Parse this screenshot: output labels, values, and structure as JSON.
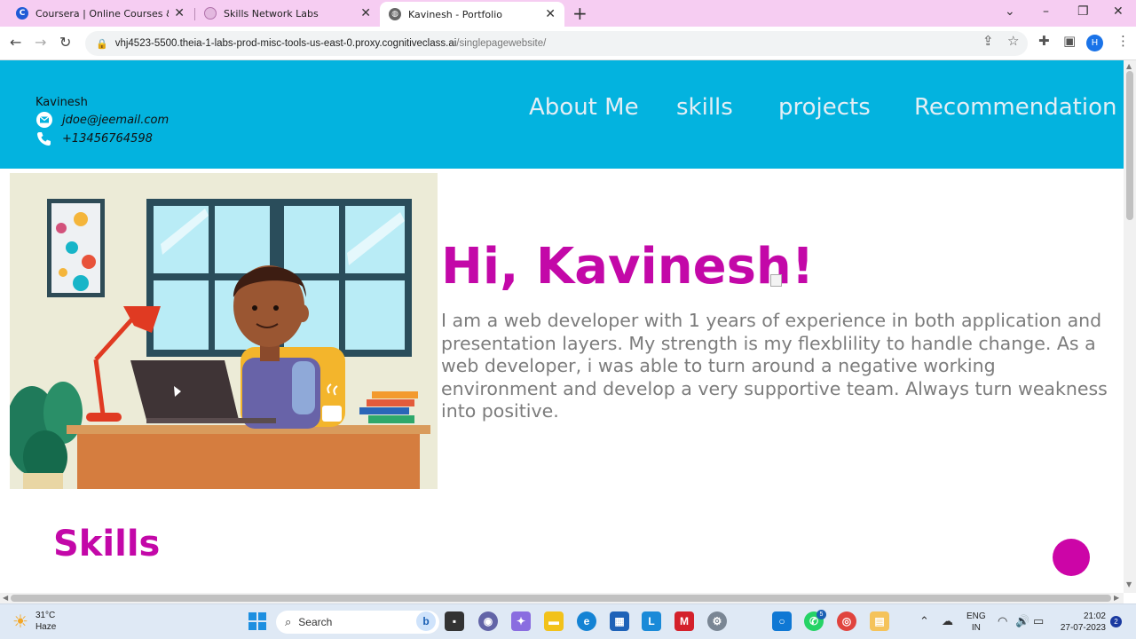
{
  "browser": {
    "tabs": [
      {
        "title": "Coursera | Online Courses & Creden",
        "favicon": "coursera-icon",
        "active": false
      },
      {
        "title": "Skills Network Labs",
        "favicon": "skills-network-icon",
        "active": false
      },
      {
        "title": "Kavinesh - Portfolio",
        "favicon": "globe-icon",
        "active": true
      }
    ],
    "url_host": "vhj4523-5500.theia-1-labs-prod-misc-tools-us-east-0.proxy.cognitiveclass.ai",
    "url_path": "/singlepagewebsite/",
    "profile_initial": "H"
  },
  "site": {
    "owner_name": "Kavinesh",
    "email": "jdoe@jeemail.com",
    "phone": "+13456764598",
    "nav": [
      "About Me",
      "skills",
      "projects",
      "Recommendation"
    ],
    "hero_title": "Hi, Kavinesh!",
    "hero_text": "I am a web developer with 1 years of experience in both application and presentation layers. My strength is my flexblility to handle change. As a web developer, i was able to turn around a negative working environment and develop a very supportive team. Always turn weakness into positive.",
    "skills_heading": "Skills",
    "colors": {
      "header": "#03b3df",
      "accent": "#c308a8",
      "body_text": "#7c7c7c"
    }
  },
  "taskbar": {
    "temperature": "31°C",
    "weather": "Haze",
    "search_placeholder": "Search",
    "language": "ENG",
    "region": "IN",
    "time": "21:02",
    "date": "27-07-2023",
    "notification_count": "2",
    "whatsapp_badge": "5"
  }
}
